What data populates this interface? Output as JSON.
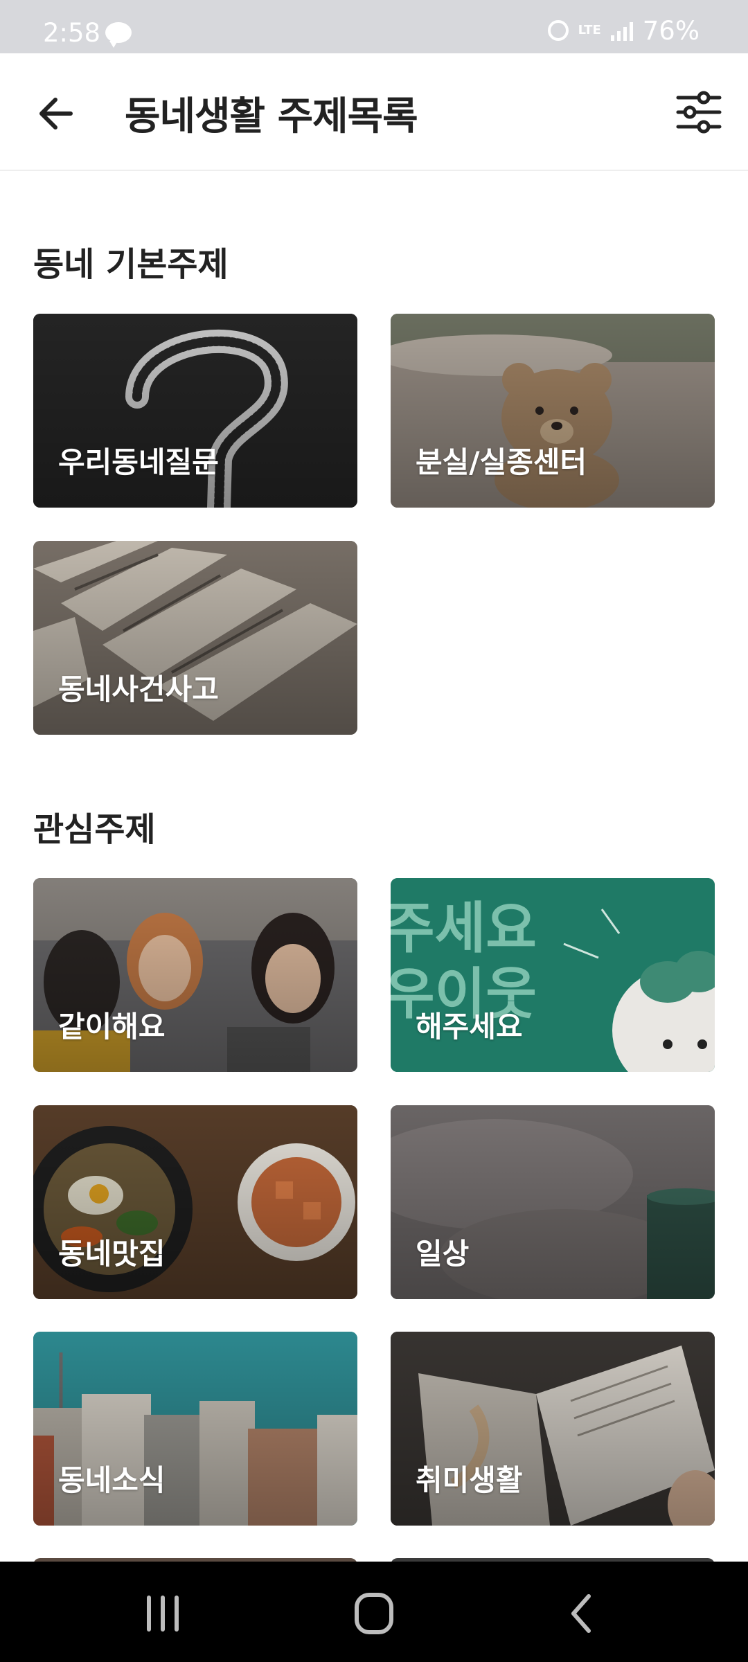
{
  "status_bar": {
    "time": "2:58",
    "battery": "76%",
    "network": "LTE"
  },
  "header": {
    "title": "동네생활 주제목록"
  },
  "sections": {
    "basic": {
      "title": "동네 기본주제",
      "cards": [
        {
          "label": "우리동네질문"
        },
        {
          "label": "분실/실종센터"
        },
        {
          "label": "동네사건사고"
        }
      ]
    },
    "interest": {
      "title": "관심주제",
      "cards": [
        {
          "label": "같이해요"
        },
        {
          "label": "해주세요"
        },
        {
          "label": "동네맛집"
        },
        {
          "label": "일상"
        },
        {
          "label": "동네소식"
        },
        {
          "label": "취미생활"
        }
      ]
    }
  },
  "colors": {
    "accent": "#1f7a66",
    "text": "#222222"
  },
  "icons": {
    "back": "arrow-left-icon",
    "filter": "sliders-icon",
    "nav_recent": "recent-apps-icon",
    "nav_home": "home-icon",
    "nav_back": "nav-back-icon"
  }
}
